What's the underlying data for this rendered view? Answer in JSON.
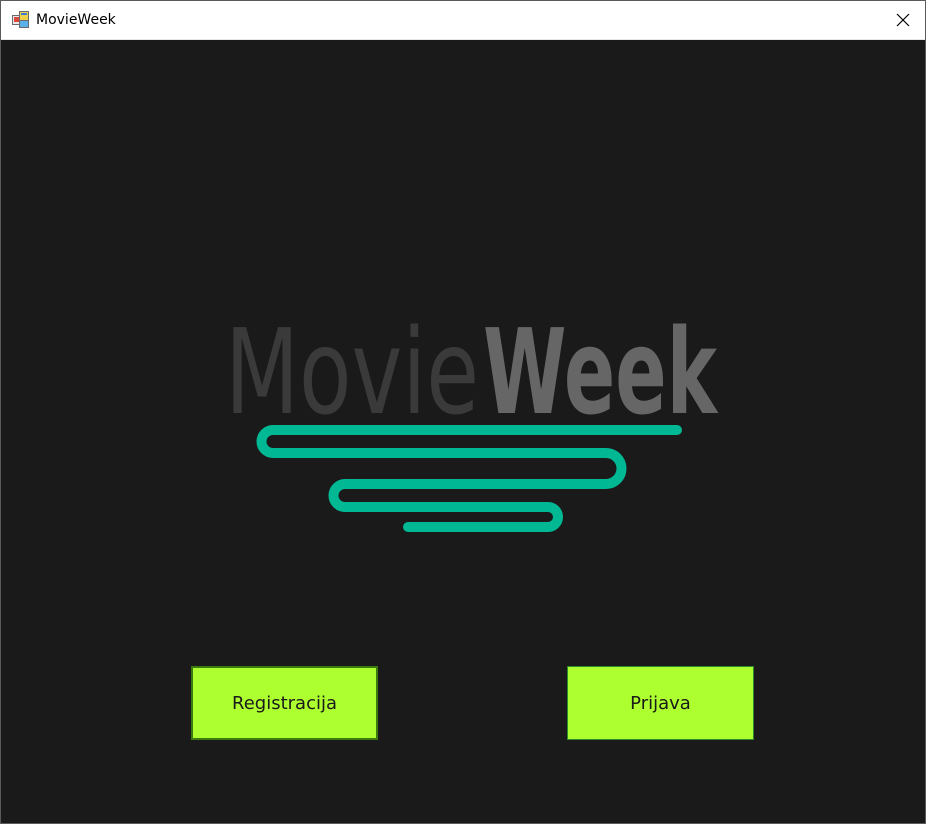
{
  "window": {
    "title": "MovieWeek"
  },
  "logo": {
    "word_part_1": "Movie",
    "word_part_2": "Week",
    "accent_color": "#00b894",
    "word_color_1": "#3a3a3a",
    "word_color_2": "#666666"
  },
  "buttons": {
    "register_label": "Registracija",
    "login_label": "Prijava",
    "button_color": "#adff2f"
  },
  "icons": {
    "app": "app-icon",
    "close": "close-icon"
  }
}
